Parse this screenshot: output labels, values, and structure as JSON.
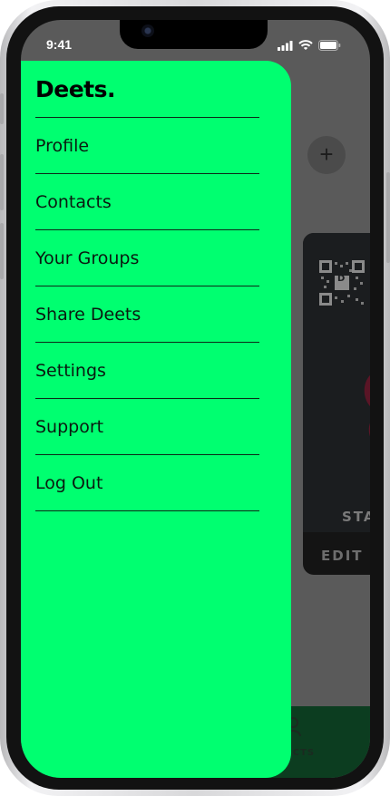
{
  "status_bar": {
    "time": "9:41"
  },
  "drawer": {
    "logo": "Deets.",
    "menu": [
      {
        "label": "Profile"
      },
      {
        "label": "Contacts"
      },
      {
        "label": "Your Groups"
      },
      {
        "label": "Share Deets"
      },
      {
        "label": "Settings"
      },
      {
        "label": "Support"
      },
      {
        "label": "Log Out"
      }
    ]
  },
  "background": {
    "add_button_label": "+",
    "card": {
      "qr_letter": "D",
      "status_text": "STA",
      "edit_label": "EDIT"
    },
    "bottom_tab_label": "ACTS"
  },
  "colors": {
    "drawer_bg": "#00ff70",
    "overlay_bg": "#5a5a5a",
    "bottom_bar": "#0c3d20"
  }
}
